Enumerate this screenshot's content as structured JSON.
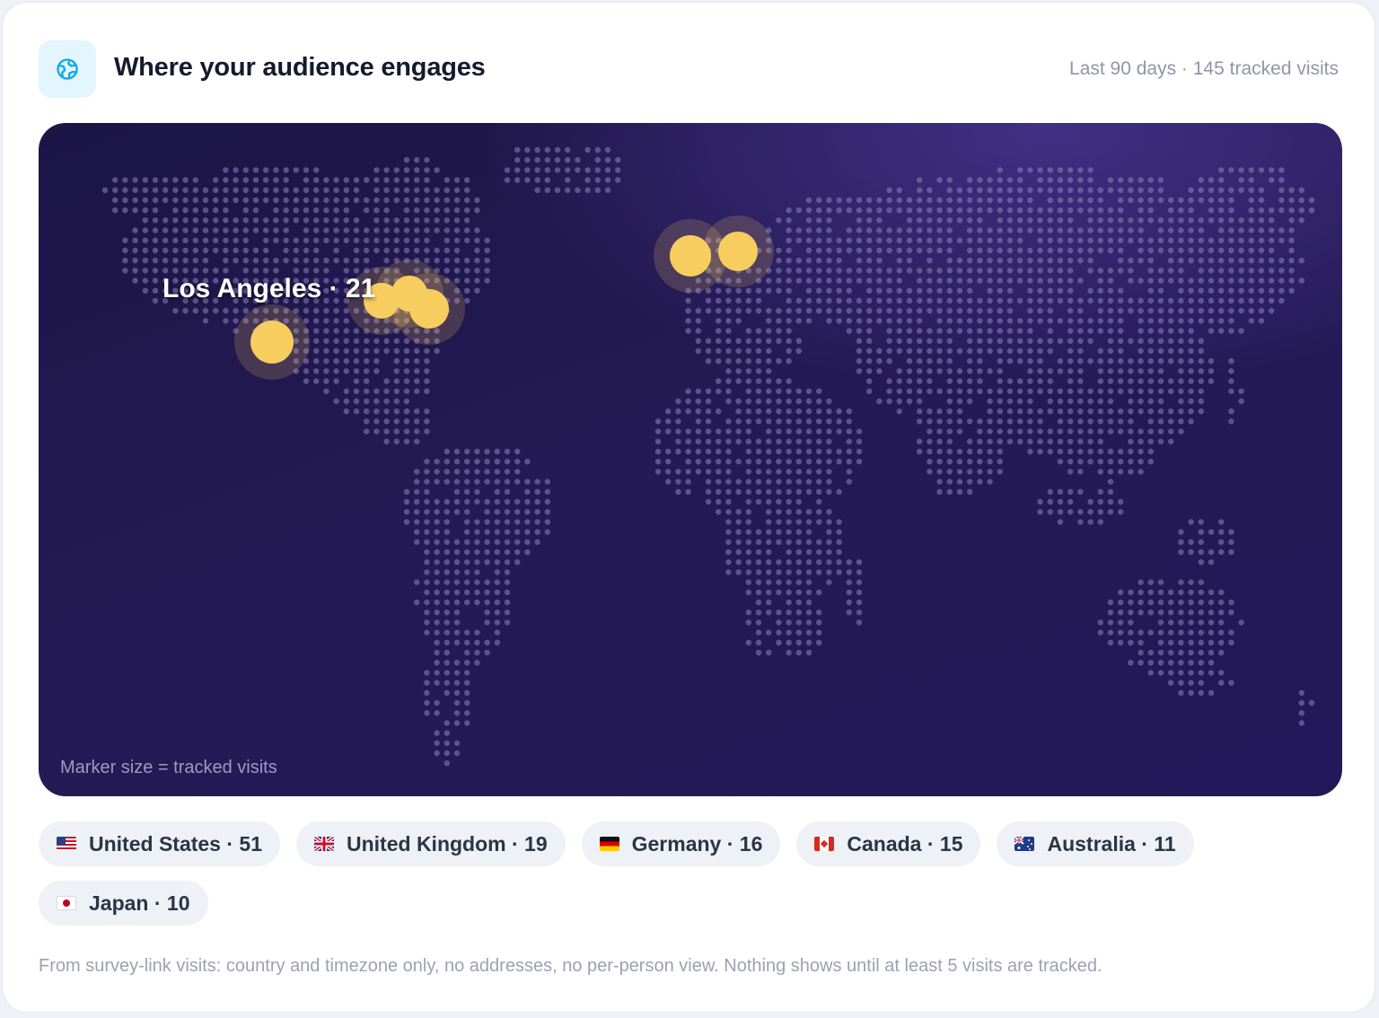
{
  "header": {
    "title": "Where your audience engages",
    "meta": "Last 90 days · 145 tracked visits",
    "icon": "globe-icon"
  },
  "map": {
    "caption": "Marker size = tracked visits",
    "highlight_label": "Los Angeles · 21",
    "dot_color": "#8c84bd",
    "marker_color": "#f8cd5f"
  },
  "countries": [
    {
      "label": "United States · 51",
      "flag": "us-flag-icon"
    },
    {
      "label": "United Kingdom · 19",
      "flag": "uk-flag-icon"
    },
    {
      "label": "Germany · 16",
      "flag": "de-flag-icon"
    },
    {
      "label": "Canada · 15",
      "flag": "ca-flag-icon"
    },
    {
      "label": "Australia · 11",
      "flag": "au-flag-icon"
    },
    {
      "label": "Japan · 10",
      "flag": "jp-flag-icon"
    }
  ],
  "footnote": "From survey-link visits: country and timezone only, no addresses, no per-person view. Nothing shows until at least 5 visits are tracked."
}
